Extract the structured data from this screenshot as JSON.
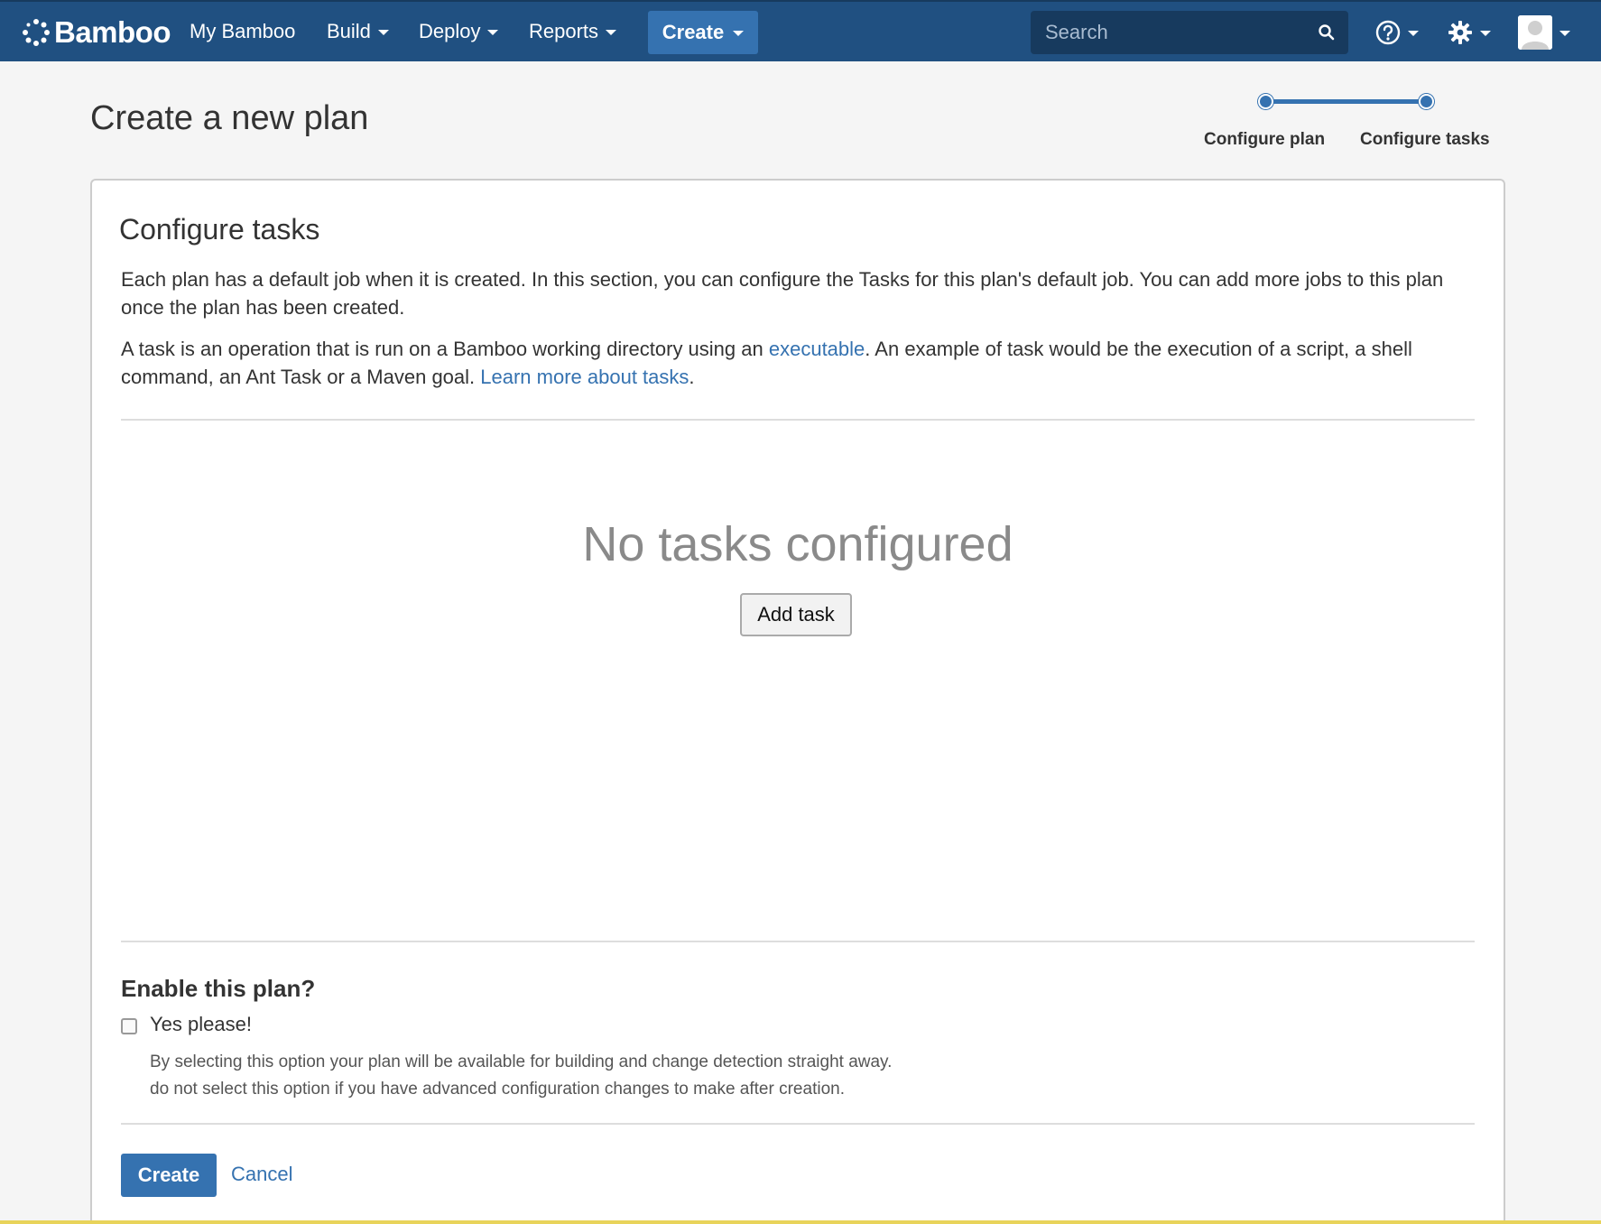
{
  "app": {
    "logo_text": "Bamboo",
    "colors": {
      "nav_bg": "#205081",
      "accent": "#3572b0",
      "search_bg": "#173a5e",
      "link": "#3572b0"
    }
  },
  "nav": {
    "items": [
      {
        "label": "My Bamboo",
        "has_dropdown": false
      },
      {
        "label": "Build",
        "has_dropdown": true
      },
      {
        "label": "Deploy",
        "has_dropdown": true
      },
      {
        "label": "Reports",
        "has_dropdown": true
      }
    ],
    "create_label": "Create",
    "search": {
      "placeholder": "Search",
      "value": ""
    },
    "icons": [
      "help-icon",
      "gear-icon",
      "avatar"
    ]
  },
  "page": {
    "title": "Create a new plan",
    "steps": [
      {
        "label": "Configure plan",
        "state": "complete"
      },
      {
        "label": "Configure tasks",
        "state": "current"
      }
    ]
  },
  "section": {
    "title": "Configure tasks",
    "intro": "Each plan has a default job when it is created. In this section, you can configure the Tasks for this plan's default job. You can add more jobs to this plan once the plan has been created.",
    "task_text_1": "A task is an operation that is run on a Bamboo working directory using an ",
    "task_link_1": "executable",
    "task_text_2": ". An example of task would be the execution of a script, a shell command, an Ant Task or a Maven goal. ",
    "task_link_2": "Learn more about tasks",
    "task_text_3": "."
  },
  "tasks": {
    "empty_title": "No tasks configured",
    "add_label": "Add task"
  },
  "enable": {
    "title": "Enable this plan?",
    "checkbox_label": "Yes please!",
    "checked": false,
    "help_line_1": "By selecting this option your plan will be available for building and change detection straight away.",
    "help_line_2": "do not select this option if you have advanced configuration changes to make after creation."
  },
  "actions": {
    "create_label": "Create",
    "cancel_label": "Cancel"
  }
}
